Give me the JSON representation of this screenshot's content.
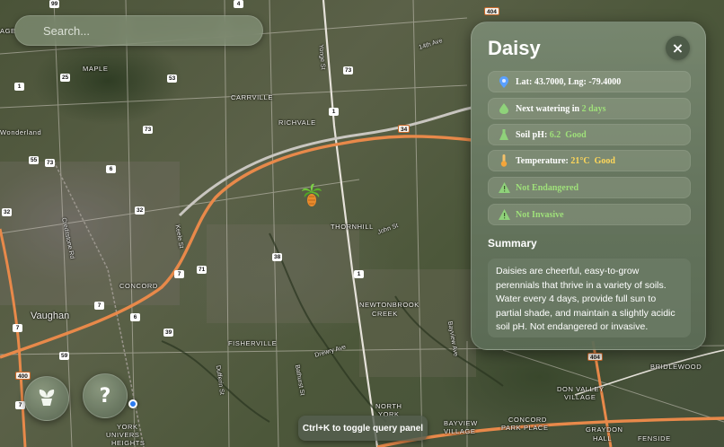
{
  "search": {
    "placeholder": "Search..."
  },
  "map": {
    "places": [
      {
        "id": "maple",
        "text": "MAPLE"
      },
      {
        "id": "carrville",
        "text": "CARRVILLE"
      },
      {
        "id": "richvale",
        "text": "RICHVALE"
      },
      {
        "id": "wonderland",
        "text": "Wonderland"
      },
      {
        "id": "thornhill",
        "text": "THORNHILL"
      },
      {
        "id": "concord",
        "text": "CONCORD"
      },
      {
        "id": "vaughan",
        "text": "Vaughan"
      },
      {
        "id": "newtonbrook",
        "text": "NEWTONBROOK"
      },
      {
        "id": "creek",
        "text": "CREEK"
      },
      {
        "id": "fisherville",
        "text": "FISHERVILLE"
      },
      {
        "id": "north",
        "text": "NORTH"
      },
      {
        "id": "york",
        "text": "YORK"
      },
      {
        "id": "york-univ",
        "text": "YORK"
      },
      {
        "id": "univers",
        "text": "UNIVERS"
      },
      {
        "id": "heights",
        "text": "HEIGHTS"
      },
      {
        "id": "bridlewood",
        "text": "BRIDLEWOOD"
      },
      {
        "id": "don-valley",
        "text": "DON VALLEY"
      },
      {
        "id": "village",
        "text": "VILLAGE"
      },
      {
        "id": "bayview",
        "text": "BAYVIEW"
      },
      {
        "id": "village2",
        "text": "VILLAGE"
      },
      {
        "id": "concord-park",
        "text": "CONCORD"
      },
      {
        "id": "park-place",
        "text": "PARK PLACE"
      },
      {
        "id": "graydon",
        "text": "GRAYDON"
      },
      {
        "id": "hall",
        "text": "HALL"
      },
      {
        "id": "fenside",
        "text": "FENSIDE"
      },
      {
        "id": "age",
        "text": "AGE"
      }
    ],
    "streets": [
      {
        "id": "s1",
        "text": "14th Ave"
      },
      {
        "id": "s2",
        "text": "John St"
      },
      {
        "id": "s3",
        "text": "Drewry Ave"
      },
      {
        "id": "s4",
        "text": "Bayview Ave"
      },
      {
        "id": "s5",
        "text": "Creditstone Rd"
      },
      {
        "id": "s6",
        "text": "Bathurst St"
      },
      {
        "id": "s7",
        "text": "Dufferin St"
      },
      {
        "id": "s8",
        "text": "Yonge St"
      },
      {
        "id": "s9",
        "text": "Keele St"
      }
    ],
    "shields": [
      {
        "id": "h1",
        "text": "404"
      },
      {
        "id": "h2",
        "text": "73"
      },
      {
        "id": "h3",
        "text": "25"
      },
      {
        "id": "h4",
        "text": "53"
      },
      {
        "id": "h5",
        "text": "73"
      },
      {
        "id": "h6",
        "text": "1"
      },
      {
        "id": "h7",
        "text": "34"
      },
      {
        "id": "h8",
        "text": "55"
      },
      {
        "id": "h9",
        "text": "73"
      },
      {
        "id": "h10",
        "text": "6"
      },
      {
        "id": "h11",
        "text": "32"
      },
      {
        "id": "h12",
        "text": "7"
      },
      {
        "id": "h13",
        "text": "71"
      },
      {
        "id": "h14",
        "text": "38"
      },
      {
        "id": "h15",
        "text": "7"
      },
      {
        "id": "h16",
        "text": "6"
      },
      {
        "id": "h17",
        "text": "1"
      },
      {
        "id": "h18",
        "text": "59"
      },
      {
        "id": "h19",
        "text": "400"
      },
      {
        "id": "h20",
        "text": "7"
      },
      {
        "id": "h21",
        "text": "404"
      },
      {
        "id": "h22",
        "text": "4"
      },
      {
        "id": "h23",
        "text": "1"
      },
      {
        "id": "h24",
        "text": "99"
      },
      {
        "id": "h25",
        "text": "32"
      },
      {
        "id": "h26",
        "text": "7"
      },
      {
        "id": "h27",
        "text": "39"
      }
    ],
    "marker_icon": "palm-tree-icon"
  },
  "fab": {
    "plant_icon": "plant-icon",
    "help_label": "?"
  },
  "hint": "Ctrl+K to toggle query panel",
  "panel": {
    "title": "Daisy",
    "close_label": "×",
    "location": {
      "label": "Lat: 43.7000, Lng: -79.4000"
    },
    "watering": {
      "label": "Next watering in",
      "value": "2 days"
    },
    "ph": {
      "label": "Soil pH:",
      "value": "6.2",
      "status": "Good"
    },
    "temperature": {
      "label": "Temperature:",
      "value": "21°C",
      "status": "Good"
    },
    "endangered": {
      "label": "Not Endangered"
    },
    "invasive": {
      "label": "Not Invasive"
    },
    "summary_heading": "Summary",
    "summary_text": "Daisies are cheerful, easy-to-grow perennials that thrive in a variety of soils. Water every 4 days, provide full sun to partial shade, and maintain a slightly acidic soil pH. Not endangered or invasive."
  },
  "colors": {
    "highway": "#e8894a",
    "ok": "#9fe07a",
    "good": "#ffd75a",
    "pin": "#5aa0ff"
  }
}
